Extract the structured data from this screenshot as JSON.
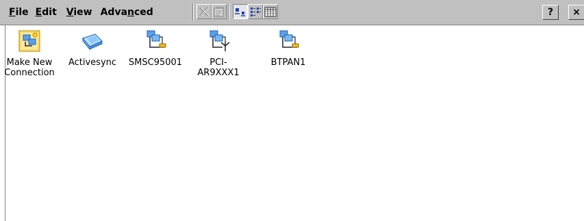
{
  "menu": [
    {
      "pre": "",
      "ul": "F",
      "post": "ile"
    },
    {
      "pre": "",
      "ul": "E",
      "post": "dit"
    },
    {
      "pre": "",
      "ul": "V",
      "post": "iew"
    },
    {
      "pre": "Adva",
      "ul": "n",
      "post": "ced"
    }
  ],
  "toolbar": {
    "buttons": [
      "delete-icon",
      "properties-icon",
      "large-icons-icon",
      "list-icon",
      "details-icon"
    ],
    "help_label": "?",
    "close_label": "×"
  },
  "connections": [
    {
      "label": "Make New\nConnection",
      "icon": "make-new-connection-icon"
    },
    {
      "label": "Activesync",
      "icon": "activesync-icon"
    },
    {
      "label": "SMSC95001",
      "icon": "wired-network-icon"
    },
    {
      "label": "PCI-\nAR9XXX1",
      "icon": "wireless-network-icon"
    },
    {
      "label": "BTPAN1",
      "icon": "wired-network-icon"
    }
  ],
  "colors": {
    "toolbar_bg": "#c0c0c0",
    "window_bg": "#ffffff",
    "icon_blue": "#3a8ad8"
  }
}
